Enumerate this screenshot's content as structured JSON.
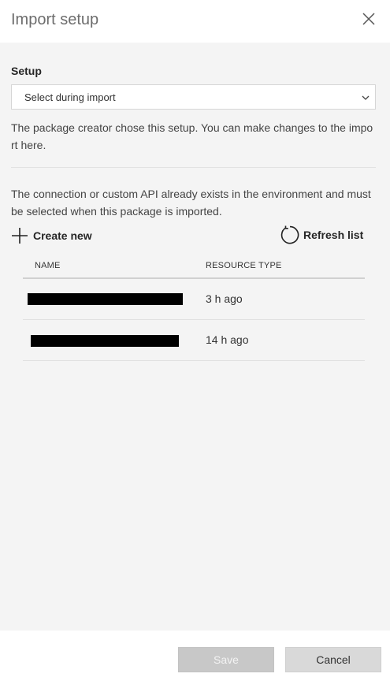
{
  "panel": {
    "title": "Import setup"
  },
  "setup": {
    "label": "Setup",
    "selected": "Select during import",
    "description": "The package creator chose this setup. You can make changes to the import here."
  },
  "connection": {
    "description": "The connection or custom API already exists in the environment and must be selected when this package is imported.",
    "create_label": "Create new",
    "refresh_label": "Refresh list"
  },
  "table": {
    "columns": [
      "NAME",
      "RESOURCE TYPE"
    ],
    "rows": [
      {
        "name": "[redacted]",
        "resource_type": "3 h ago"
      },
      {
        "name": "[redacted]",
        "resource_type": "14 h ago"
      }
    ]
  },
  "footer": {
    "save_label": "Save",
    "cancel_label": "Cancel"
  },
  "colors": {
    "content_background": "#f4f4f4",
    "disabled_button": "#c8c8c8",
    "secondary_button": "#d9d9d9"
  }
}
